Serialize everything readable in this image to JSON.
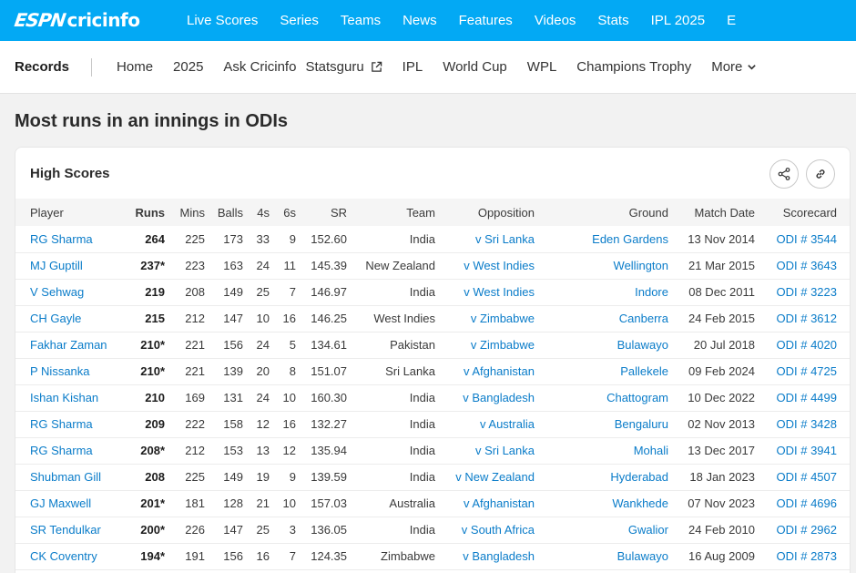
{
  "brand": {
    "espn": "ESPN",
    "cricinfo": "cricinfo"
  },
  "topnav": [
    "Live Scores",
    "Series",
    "Teams",
    "News",
    "Features",
    "Videos",
    "Stats",
    "IPL 2025",
    "E"
  ],
  "subnav": {
    "section": "Records",
    "items": [
      "Home",
      "2025",
      "Ask Cricinfo",
      "Statsguru",
      "IPL",
      "World Cup",
      "WPL",
      "Champions Trophy",
      "More"
    ]
  },
  "page_title": "Most runs in an innings in ODIs",
  "card": {
    "title": "High Scores",
    "icons": {
      "share": "share-icon",
      "link": "link-icon"
    }
  },
  "table": {
    "headers": [
      "Player",
      "Runs",
      "Mins",
      "Balls",
      "4s",
      "6s",
      "SR",
      "Team",
      "Opposition",
      "Ground",
      "Match Date",
      "Scorecard"
    ],
    "rows": [
      [
        "RG Sharma",
        "264",
        "225",
        "173",
        "33",
        "9",
        "152.60",
        "India",
        "v Sri Lanka",
        "Eden Gardens",
        "13 Nov 2014",
        "ODI # 3544"
      ],
      [
        "MJ Guptill",
        "237*",
        "223",
        "163",
        "24",
        "11",
        "145.39",
        "New Zealand",
        "v West Indies",
        "Wellington",
        "21 Mar 2015",
        "ODI # 3643"
      ],
      [
        "V Sehwag",
        "219",
        "208",
        "149",
        "25",
        "7",
        "146.97",
        "India",
        "v West Indies",
        "Indore",
        "08 Dec 2011",
        "ODI # 3223"
      ],
      [
        "CH Gayle",
        "215",
        "212",
        "147",
        "10",
        "16",
        "146.25",
        "West Indies",
        "v Zimbabwe",
        "Canberra",
        "24 Feb 2015",
        "ODI # 3612"
      ],
      [
        "Fakhar Zaman",
        "210*",
        "221",
        "156",
        "24",
        "5",
        "134.61",
        "Pakistan",
        "v Zimbabwe",
        "Bulawayo",
        "20 Jul 2018",
        "ODI # 4020"
      ],
      [
        "P Nissanka",
        "210*",
        "221",
        "139",
        "20",
        "8",
        "151.07",
        "Sri Lanka",
        "v Afghanistan",
        "Pallekele",
        "09 Feb 2024",
        "ODI # 4725"
      ],
      [
        "Ishan Kishan",
        "210",
        "169",
        "131",
        "24",
        "10",
        "160.30",
        "India",
        "v Bangladesh",
        "Chattogram",
        "10 Dec 2022",
        "ODI # 4499"
      ],
      [
        "RG Sharma",
        "209",
        "222",
        "158",
        "12",
        "16",
        "132.27",
        "India",
        "v Australia",
        "Bengaluru",
        "02 Nov 2013",
        "ODI # 3428"
      ],
      [
        "RG Sharma",
        "208*",
        "212",
        "153",
        "13",
        "12",
        "135.94",
        "India",
        "v Sri Lanka",
        "Mohali",
        "13 Dec 2017",
        "ODI # 3941"
      ],
      [
        "Shubman Gill",
        "208",
        "225",
        "149",
        "19",
        "9",
        "139.59",
        "India",
        "v New Zealand",
        "Hyderabad",
        "18 Jan 2023",
        "ODI # 4507"
      ],
      [
        "GJ Maxwell",
        "201*",
        "181",
        "128",
        "21",
        "10",
        "157.03",
        "Australia",
        "v Afghanistan",
        "Wankhede",
        "07 Nov 2023",
        "ODI # 4696"
      ],
      [
        "SR Tendulkar",
        "200*",
        "226",
        "147",
        "25",
        "3",
        "136.05",
        "India",
        "v South Africa",
        "Gwalior",
        "24 Feb 2010",
        "ODI # 2962"
      ],
      [
        "CK Coventry",
        "194*",
        "191",
        "156",
        "16",
        "7",
        "124.35",
        "Zimbabwe",
        "v Bangladesh",
        "Bulawayo",
        "16 Aug 2009",
        "ODI # 2873"
      ]
    ]
  },
  "colors": {
    "brand": "#03a9f4",
    "link": "#0a7cc9"
  }
}
